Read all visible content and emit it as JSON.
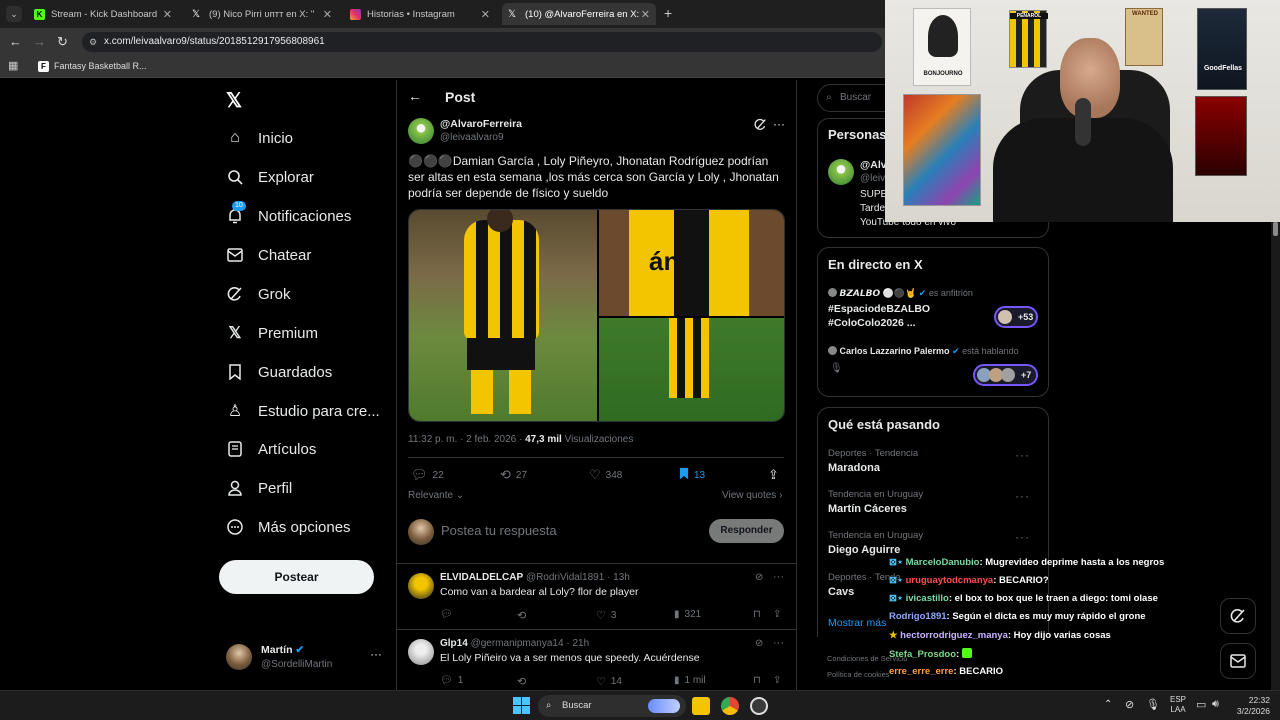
{
  "browser": {
    "tabs": [
      {
        "title": "Stream - Kick Dashboard",
        "favicon": "kick-icon",
        "color": "#53fc18"
      },
      {
        "title": "(9) Nico Pirri υптт en X: \"",
        "favicon": "x-icon",
        "color": "#ffffff"
      },
      {
        "title": "Historias • Instagram",
        "favicon": "instagram-icon",
        "color": "#e1306c"
      },
      {
        "title": "(10) @AlvaroFerreira en X: \"",
        "favicon": "x-icon",
        "color": "#ffffff"
      }
    ],
    "url": "x.com/leivaalvaro9/status/2018512917956808961",
    "bookmark": "Fantasy Basketball R..."
  },
  "sidebar": {
    "items": [
      {
        "label": "Inicio",
        "icon": "home-icon"
      },
      {
        "label": "Explorar",
        "icon": "search-icon"
      },
      {
        "label": "Notificaciones",
        "icon": "bell-icon",
        "badge": "10"
      },
      {
        "label": "Chatear",
        "icon": "mail-icon"
      },
      {
        "label": "Grok",
        "icon": "grok-icon"
      },
      {
        "label": "Premium",
        "icon": "x-logo-icon"
      },
      {
        "label": "Guardados",
        "icon": "bookmark-icon"
      },
      {
        "label": "Estudio para cre...",
        "icon": "studio-icon"
      },
      {
        "label": "Artículos",
        "icon": "article-icon"
      },
      {
        "label": "Perfil",
        "icon": "user-icon"
      },
      {
        "label": "Más opciones",
        "icon": "more-icon"
      }
    ],
    "post_button": "Postear",
    "account": {
      "name": "Martín",
      "handle": "@SordelliMartin"
    }
  },
  "post": {
    "header": "Post",
    "author_name": "@AlvaroFerreira",
    "author_handle": "@leivaalvaro9",
    "text": "⚫⚫⚫Damian García , Loly Piñeyro, Jhonatan Rodríguez podrían ser altas en esta semana ,los más cerca son García y Loly , Jhonatan podría ser depende de físico y sueldo",
    "timestamp": "11:32 p. m. · 2 feb. 2026 · ",
    "views_count": "47,3 mil",
    "views_label": " Visualizaciones",
    "stats": {
      "replies": "22",
      "reposts": "27",
      "likes": "348",
      "bookmarks": "13"
    },
    "sort_label": "Relevante",
    "view_quotes": "View quotes",
    "reply_placeholder": "Postea tu respuesta",
    "reply_button": "Responder"
  },
  "replies": [
    {
      "name": "ELVIDALDELCAP",
      "handle": "@RodriVidal1891 · 13h",
      "text": "Como van a bardear al Loly? flor de player",
      "likes": "3",
      "views": "321"
    },
    {
      "name": "Glp14",
      "handle": "@germanipmanya14 · 21h",
      "text": "El Loly Piñeiro va a ser menos que speedy. Acuérdense",
      "replies": "1",
      "likes": "14",
      "views": "1 mil"
    }
  ],
  "right": {
    "search_placeholder": "Buscar",
    "who_to_follow_title": "Personas",
    "suggest_name": "@Alv",
    "suggest_handle": "@leiv",
    "suggest_bio_1": "SUPE",
    "suggest_bio_2": "Tarde",
    "suggest_bio_3": "YouTube todo en vivo",
    "live": {
      "title": "En directo en X",
      "space1_host": "𝘽𝙕𝘼𝙇𝘽𝙊 ⚪⚫🤘",
      "space1_role": "es anfitrión",
      "space1_title1": "#EspaciodeBZALBO",
      "space1_title2": "#ColoColo2026 ...",
      "space1_count": "+53",
      "space2_host": "Carlos Lazzarino Palermo",
      "space2_role": "está hablando",
      "space2_count": "+7"
    },
    "trends_title": "Qué está pasando",
    "trends": [
      {
        "meta": "Deportes · Tendencia",
        "name": "Maradona"
      },
      {
        "meta": "Tendencia en Uruguay",
        "name": "Martín Cáceres"
      },
      {
        "meta": "Tendencia en Uruguay",
        "name": "Diego Aguirre"
      },
      {
        "meta": "Deportes · Tende",
        "name": "Cavs"
      }
    ],
    "show_more": "Mostrar más",
    "footer1": "Condiciones de Servicio",
    "footer2": "Política de cookies"
  },
  "chat": [
    {
      "user": "MarceloDanubio",
      "color": "#7bd9a5",
      "msg": ": Mugrevideo deprime hasta a los negros"
    },
    {
      "user": "uruguaytodcmanya",
      "color": "#ff4d4d",
      "msg": ": BECARIO?"
    },
    {
      "user": "ivicastillo",
      "color": "#7bd9a5",
      "msg": ": el box to box que le traen a diego: tomi olase"
    },
    {
      "user": "Rodrigo1891",
      "color": "#8fa8ff",
      "msg": ": Según el dicta es muy muy rápido el grone"
    },
    {
      "user": "hectorrodriguez_manya",
      "color": "#c9b3ff",
      "msg": ": Hoy dijo varias cosas"
    },
    {
      "user": "Stefa_Prosdoo",
      "color": "#7bd98a",
      "msg": ":"
    },
    {
      "user": "erre_erre_erre",
      "color": "#ff9f40",
      "msg": ": BECARIO"
    }
  ],
  "taskbar": {
    "search": "Buscar",
    "lang1": "ESP",
    "lang2": "LAA",
    "time": "22:32",
    "date": "3/2/2026"
  },
  "webcam_posters": [
    "BONJOURNO",
    "PEÑAROL",
    "WANTED",
    "GoodFellas"
  ]
}
